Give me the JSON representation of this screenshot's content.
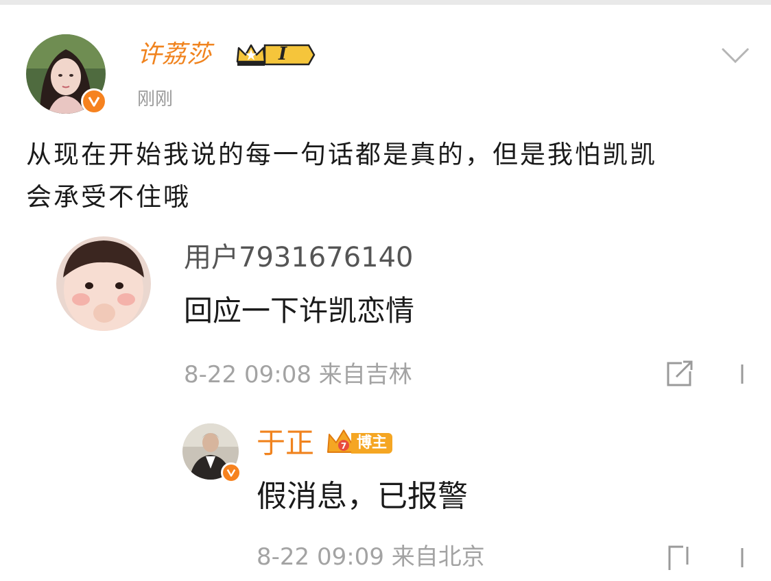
{
  "post": {
    "author_name": "许荔莎",
    "vip_level": "I",
    "time": "刚刚",
    "content_line1": "从现在开始我说的每一句话都是真的，但是我怕凯凯",
    "content_line2": "会承受不住哦"
  },
  "comment": {
    "user_name": "用户7931676140",
    "text": "回应一下许凯恋情",
    "meta": "8-22 09:08 来自吉林"
  },
  "reply": {
    "user_name": "于正",
    "badge_label": "博主",
    "text": "假消息，已报警",
    "meta": "8-22 09:09 来自北京"
  },
  "colors": {
    "accent": "#f0831e",
    "muted": "#9a9a9a",
    "text": "#1a1a1a"
  },
  "icons": [
    "chevron-down-icon",
    "verified-icon",
    "vip-crown-icon",
    "share-icon",
    "more-icon"
  ]
}
